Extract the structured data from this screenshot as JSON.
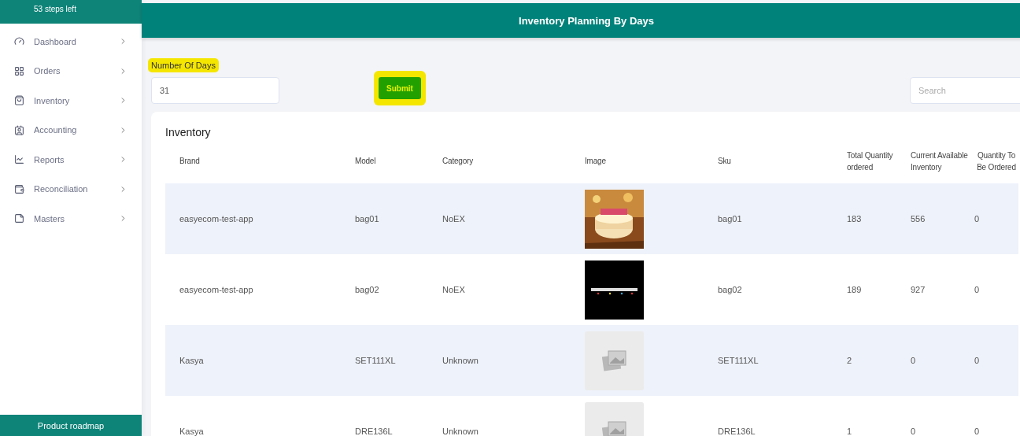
{
  "sidebar": {
    "steps_banner": "53 steps left",
    "items": [
      {
        "label": "Dashboard"
      },
      {
        "label": "Orders"
      },
      {
        "label": "Inventory"
      },
      {
        "label": "Accounting"
      },
      {
        "label": "Reports"
      },
      {
        "label": "Reconciliation"
      },
      {
        "label": "Masters"
      }
    ],
    "footer_button": "Product roadmap"
  },
  "header": {
    "title": "Inventory Planning By Days"
  },
  "form": {
    "label": "Number Of Days",
    "label_highlighted": true,
    "days_value": "31",
    "submit": "Submit",
    "submit_highlighted": true,
    "search_placeholder": "Search"
  },
  "table": {
    "title": "Inventory",
    "columns": [
      "Brand",
      "Model",
      "Category",
      "Image",
      "Sku",
      "Total Quantity ordered",
      "Current Available Inventory",
      "Quantity To Be Ordered"
    ],
    "rows": [
      {
        "brand": "easyecom-test-app",
        "model": "bag01",
        "category": "NoEX",
        "sku": "bag01",
        "total": "183",
        "available": "556",
        "to_order": "0"
      },
      {
        "brand": "easyecom-test-app",
        "model": "bag02",
        "category": "NoEX",
        "sku": "bag02",
        "total": "189",
        "available": "927",
        "to_order": "0"
      },
      {
        "brand": "Kasya",
        "model": "SET111XL",
        "category": "Unknown",
        "image": {
          "kind": "placeholder"
        },
        "sku": "SET111XL",
        "total": "2",
        "available": "0",
        "to_order": "0"
      },
      {
        "brand": "Kasya",
        "model": "DRE136L",
        "category": "Unknown",
        "image": {
          "kind": "placeholder"
        },
        "sku": "DRE136L",
        "total": "1",
        "available": "0",
        "to_order": "0"
      }
    ]
  }
}
